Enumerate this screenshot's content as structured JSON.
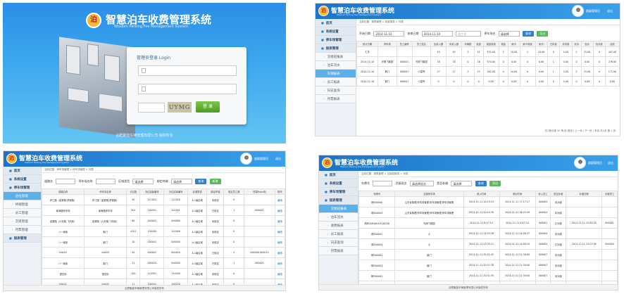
{
  "login": {
    "logo_char": "泊",
    "title": "智慧泊车收费管理系统",
    "subtitle": "Wisdom Parking Fee Management System",
    "panel_title": "管理员登录  Login",
    "captcha": "UYMG",
    "button": "登 录",
    "footer": "合肥聚能车辆管理有限公司 版权所有"
  },
  "header": {
    "logo_char": "泊",
    "title": "智慧泊车收费管理系统",
    "subtitle": "Wisdom Parking Fee Management System",
    "user": "超级管理员",
    "logout": "退出"
  },
  "menu2": [
    "首页",
    "系统设置",
    "停车场管理",
    "报表管理",
    "交接班报表",
    "泊车流水",
    "车辆报表",
    "员工报表",
    "日志查询",
    "月票报表"
  ],
  "menu3": [
    "首页",
    "系统设置",
    "停车场管理",
    "泊位管理",
    "终端管理",
    "员工管理",
    "交接管理",
    "月票管理",
    "报表管理"
  ],
  "menu4": [
    "首页",
    "系统设置",
    "停车场管理",
    "报表管理",
    "交接班报表",
    "泊车流水",
    "收费报表",
    "员工报表",
    "日志查询",
    "月票报表"
  ],
  "revenue": {
    "crumb": "当前位置：报表管理 > 收费报表 > 列表",
    "start_label": "开始日期",
    "start_value": "2014-11-10",
    "end_label": "结束日期",
    "end_value": "2014-11-10",
    "staff_placeholder": "员工号",
    "lot_label": "停车场名",
    "lot_value": "请选择",
    "search": "查询",
    "export": "导出",
    "headers": [
      "统计日期",
      "停车场",
      "员工编号",
      "员工姓名",
      "应收入额",
      "实收入额",
      "车辆数",
      "免费",
      "现金收费",
      "现金",
      "刷卡",
      "刷卡收费",
      "刷卡",
      "已扣费",
      "未扣费",
      "未扣",
      "包月",
      "包月费",
      "应收"
    ],
    "rows": [
      [
        "汇总",
        "",
        "",
        "",
        "45",
        "45",
        "2",
        "41",
        "532.00",
        "1",
        "10.00",
        "1",
        "10.00",
        "0",
        "0.00",
        "2",
        "15.00",
        "0",
        "447.00"
      ],
      [
        "2014-11-10",
        "光明飞鹅园",
        "000001",
        "光明飞鹅园",
        "18",
        "18",
        "0",
        "16",
        "570.00",
        "0",
        "0.00",
        "0",
        "0.00",
        "1",
        "0.00",
        "0",
        "0.00",
        "0",
        "276.00"
      ],
      [
        "2014-11-10",
        "鹅门",
        "000007",
        "小豪哥",
        "27",
        "27",
        "2",
        "23",
        "262.00",
        "0",
        "10.00",
        "0",
        "0.00",
        "1",
        "0.00",
        "2",
        "15.00",
        "0",
        "171.00"
      ],
      [
        "2014-11-10",
        "鹅门",
        "000007",
        "小豪哥",
        "0",
        "0",
        "0",
        "0",
        "0.00",
        "0",
        "0.00",
        "0",
        "0.00",
        "0",
        "0.00",
        "0",
        "0.00",
        "0",
        "0.00"
      ]
    ],
    "pager": "共1条记录  10 条/页  首页 | 上一页 | 下一页 | 末页  共1页  第 1 页"
  },
  "lots": {
    "crumb": "当前位置：停车场管理 > 停车场管理 > 列表",
    "f1": "道路名",
    "f2": "停车场名称",
    "f3": "区域类型",
    "f3v": "请选择",
    "f4": "绑定终端",
    "f4v": "请选择",
    "search": "查询",
    "add": "新增",
    "headers": [
      "道路名称",
      "停车场名称",
      "泊位数",
      "泊位起始编号",
      "泊位结束编号",
      "区域类型",
      "绑定终端",
      "绑定员工数",
      "终端Posid标",
      "操作"
    ],
    "rows": [
      [
        "庐江路（金寨路-舒城路）",
        "庐江路（金寨路-舒城路）",
        "50",
        "111001",
        "111050",
        "A-1级区域",
        "未绑定",
        "0",
        "",
        "编辑"
      ],
      [
        "南海路停车场",
        "南海路停车场",
        "501",
        "200501",
        "201001",
        "A-2级区域",
        "已绑定",
        "1",
        "000001",
        "编辑"
      ],
      [
        "金寨路（六安路-飞凤街）",
        "金寨路（六安路-飞凤街）",
        "60",
        "400001",
        "400060",
        "A-1级区域",
        "未绑定",
        "0",
        "",
        "编辑"
      ],
      [
        "八一南街",
        "鹅门",
        "4201",
        "100400",
        "101000",
        "A-1级区域",
        "未绑定",
        "0",
        "",
        "编辑"
      ],
      [
        "八一南街",
        "鹅门",
        "10",
        "000041",
        "000050",
        "A-1级区域",
        "未绑定",
        "0",
        "",
        "编辑"
      ],
      [
        "test03",
        "test03",
        "20",
        "000001",
        "000020",
        "A-1级区域",
        "已绑定",
        "2",
        "000000,000010",
        "编辑"
      ],
      [
        "八一南街",
        "鹅门",
        "11",
        "000020",
        "000030",
        "A-1级区域",
        "已绑定",
        "1",
        "000001",
        "编辑"
      ],
      [
        "银杏街",
        "银杏街",
        "100",
        "110301",
        "110400",
        "A-1级区域",
        "未绑定",
        "0",
        "",
        "编辑"
      ],
      [
        "test02",
        "test02",
        "11",
        "100201",
        "100220",
        "A-1级区域",
        "未绑定",
        "0",
        "",
        "编辑"
      ]
    ],
    "footer": "合肥聚能车辆管理有限公司版权所有"
  },
  "records": {
    "crumb": "当前位置：报表管理 > 交接班报表 > 列表",
    "f1": "车牌号",
    "f2": "交接班次",
    "f2v": "请选择班次",
    "f3": "是否补缴",
    "f3v": "请选择",
    "search": "查询",
    "export": "导出",
    "headers": [
      "车牌号",
      "交接停车场",
      "驶入时间",
      "驶出时间",
      "驶入员工",
      "是否补缴",
      "补缴日期",
      "补缴员工"
    ],
    "rows": [
      [
        "皖000000",
        "山东省管理;停车场管理;停车场管理;停车场管理",
        "2014-11-11 10:15:23",
        "2014-11-11 17:17:17",
        "000004",
        "未补缴",
        "",
        ""
      ],
      [
        "皖A00004",
        "山东省管理;停车场管理;停车场管理;停车场管理",
        "2014-11-11 10:14:39",
        "2014-11-11 16:45:49",
        "000004",
        "未补缴",
        "",
        ""
      ],
      [
        "皖BD0K5JKLK5QAD58",
        "光明飞鹅园",
        "2014-11-11 8:47:14",
        "2014-11-11 8:47:14",
        "000001",
        "已补缴",
        "2014-11-11 15:04:18",
        "000001"
      ],
      [
        "皖A00002",
        "小",
        "2014-11-11 13:35:28",
        "2014-11-11 14:00:37",
        "000004",
        "未补缴",
        "",
        ""
      ],
      [
        "皖A00004",
        "小",
        "2014-11-11 13:35:21",
        "2014-11-11 14:00:10",
        "000004",
        "已补缴",
        "2014-11-11 14:27:46",
        "000004"
      ],
      [
        "皖D00004",
        "鹅门",
        "2014-11-11 20:31:42",
        "2014-11-11 21:30:00",
        "000007",
        "未补缴",
        "",
        ""
      ],
      [
        "皖D00003",
        "鹅门",
        "2014-11-11 20:31:38",
        "2014-11-11 21:30:00",
        "000007",
        "未补缴",
        "",
        ""
      ],
      [
        "皖D00002",
        "鹅门",
        "2014-11-11 20:31:35",
        "2014-11-11 21:30:00",
        "000007",
        "未补缴",
        "",
        ""
      ],
      [
        "皖D00001",
        "鹅门",
        "2014-11-11 20:31:30",
        "2014-11-11 21:30:00",
        "000007",
        "未补缴",
        "",
        ""
      ]
    ],
    "footer": "合肥聚能车辆管理有限公司版权所有"
  }
}
